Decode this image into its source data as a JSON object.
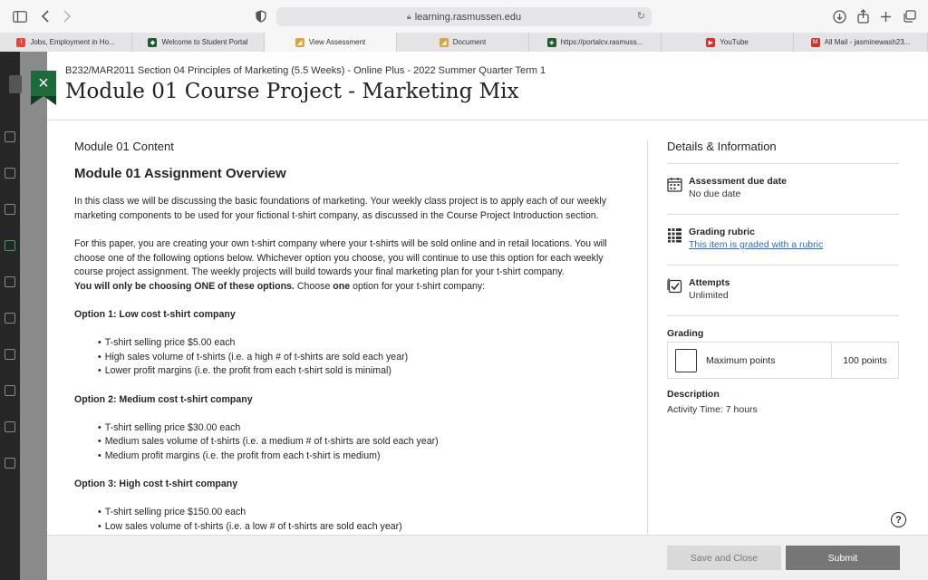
{
  "browser": {
    "url": "learning.rasmussen.edu",
    "tabs": [
      {
        "label": "Jobs, Employment in Ho...",
        "fav_color": "#e24a3b",
        "fav_char": "I"
      },
      {
        "label": "Welcome to Student Portal",
        "fav_color": "#1e5a2e",
        "fav_char": "◆"
      },
      {
        "label": "View Assessment",
        "fav_color": "#d9a441",
        "fav_char": "◢",
        "active": true
      },
      {
        "label": "Document",
        "fav_color": "#d9a441",
        "fav_char": "◢"
      },
      {
        "label": "https://portalcv.rasmuss...",
        "fav_color": "#1e5a2e",
        "fav_char": "◈"
      },
      {
        "label": "YouTube",
        "fav_color": "#e02b2b",
        "fav_char": "▶"
      },
      {
        "label": "All Mail - jasminewash23...",
        "fav_color": "#c9362e",
        "fav_char": "M"
      }
    ]
  },
  "assessment": {
    "course": "B232/MAR2011 Section 04 Principles of Marketing (5.5 Weeks) - Online Plus - 2022 Summer Quarter Term 1",
    "title": "Module 01 Course Project - Marketing Mix",
    "close_label": "×"
  },
  "content": {
    "section": "Module 01 Content",
    "heading": "Module 01 Assignment Overview",
    "intro": "In this class we will be discussing the basic foundations of marketing. Your weekly class project is to apply each of our weekly marketing components to be used for your fictional t-shirt company, as discussed in the Course Project Introduction section.",
    "paper": "For this paper, you are creating your own t-shirt company where your t-shirts will be sold online and in retail locations. You will choose one of the following options below. Whichever option you choose, you will continue to use this option for each weekly course project assignment. The weekly projects will build towards your final marketing plan for your t-shirt company.",
    "choose_bold": "You will only be choosing ONE of these options.",
    "choose_pre": " Choose ",
    "choose_one": "one",
    "choose_post": " option for your t-shirt company:",
    "options": [
      {
        "title": "Option 1: Low cost t-shirt company",
        "bullets": [
          "T-shirt selling price $5.00 each",
          "High sales volume of t-shirts (i.e. a high # of t-shirts are sold each year)",
          "Lower profit margins (i.e. the profit from each t-shirt sold is minimal)"
        ]
      },
      {
        "title": "Option 2: Medium cost t-shirt company",
        "bullets": [
          "T-shirt selling price $30.00 each",
          "Medium sales volume of t-shirts (i.e. a medium # of t-shirts are sold each year)",
          "Medium profit margins (i.e. the profit from each t-shirt is medium)"
        ]
      },
      {
        "title": "Option 3: High cost t-shirt company",
        "bullets": [
          "T-shirt selling price $150.00 each",
          "Low sales volume of t-shirts (i.e. a low # of t-shirts are sold each year)"
        ]
      }
    ]
  },
  "details": {
    "heading": "Details & Information",
    "due_label": "Assessment due date",
    "due_value": "No due date",
    "rubric_label": "Grading rubric",
    "rubric_link": "This item is graded with a rubric",
    "attempts_label": "Attempts",
    "attempts_value": "Unlimited",
    "grading_label": "Grading",
    "max_points_label": "Maximum points",
    "max_points_value": "100 points",
    "description_label": "Description",
    "description_value": "Activity Time: 7 hours"
  },
  "footer": {
    "save_label": "Save and Close",
    "submit_label": "Submit"
  },
  "help_icon_char": "?"
}
